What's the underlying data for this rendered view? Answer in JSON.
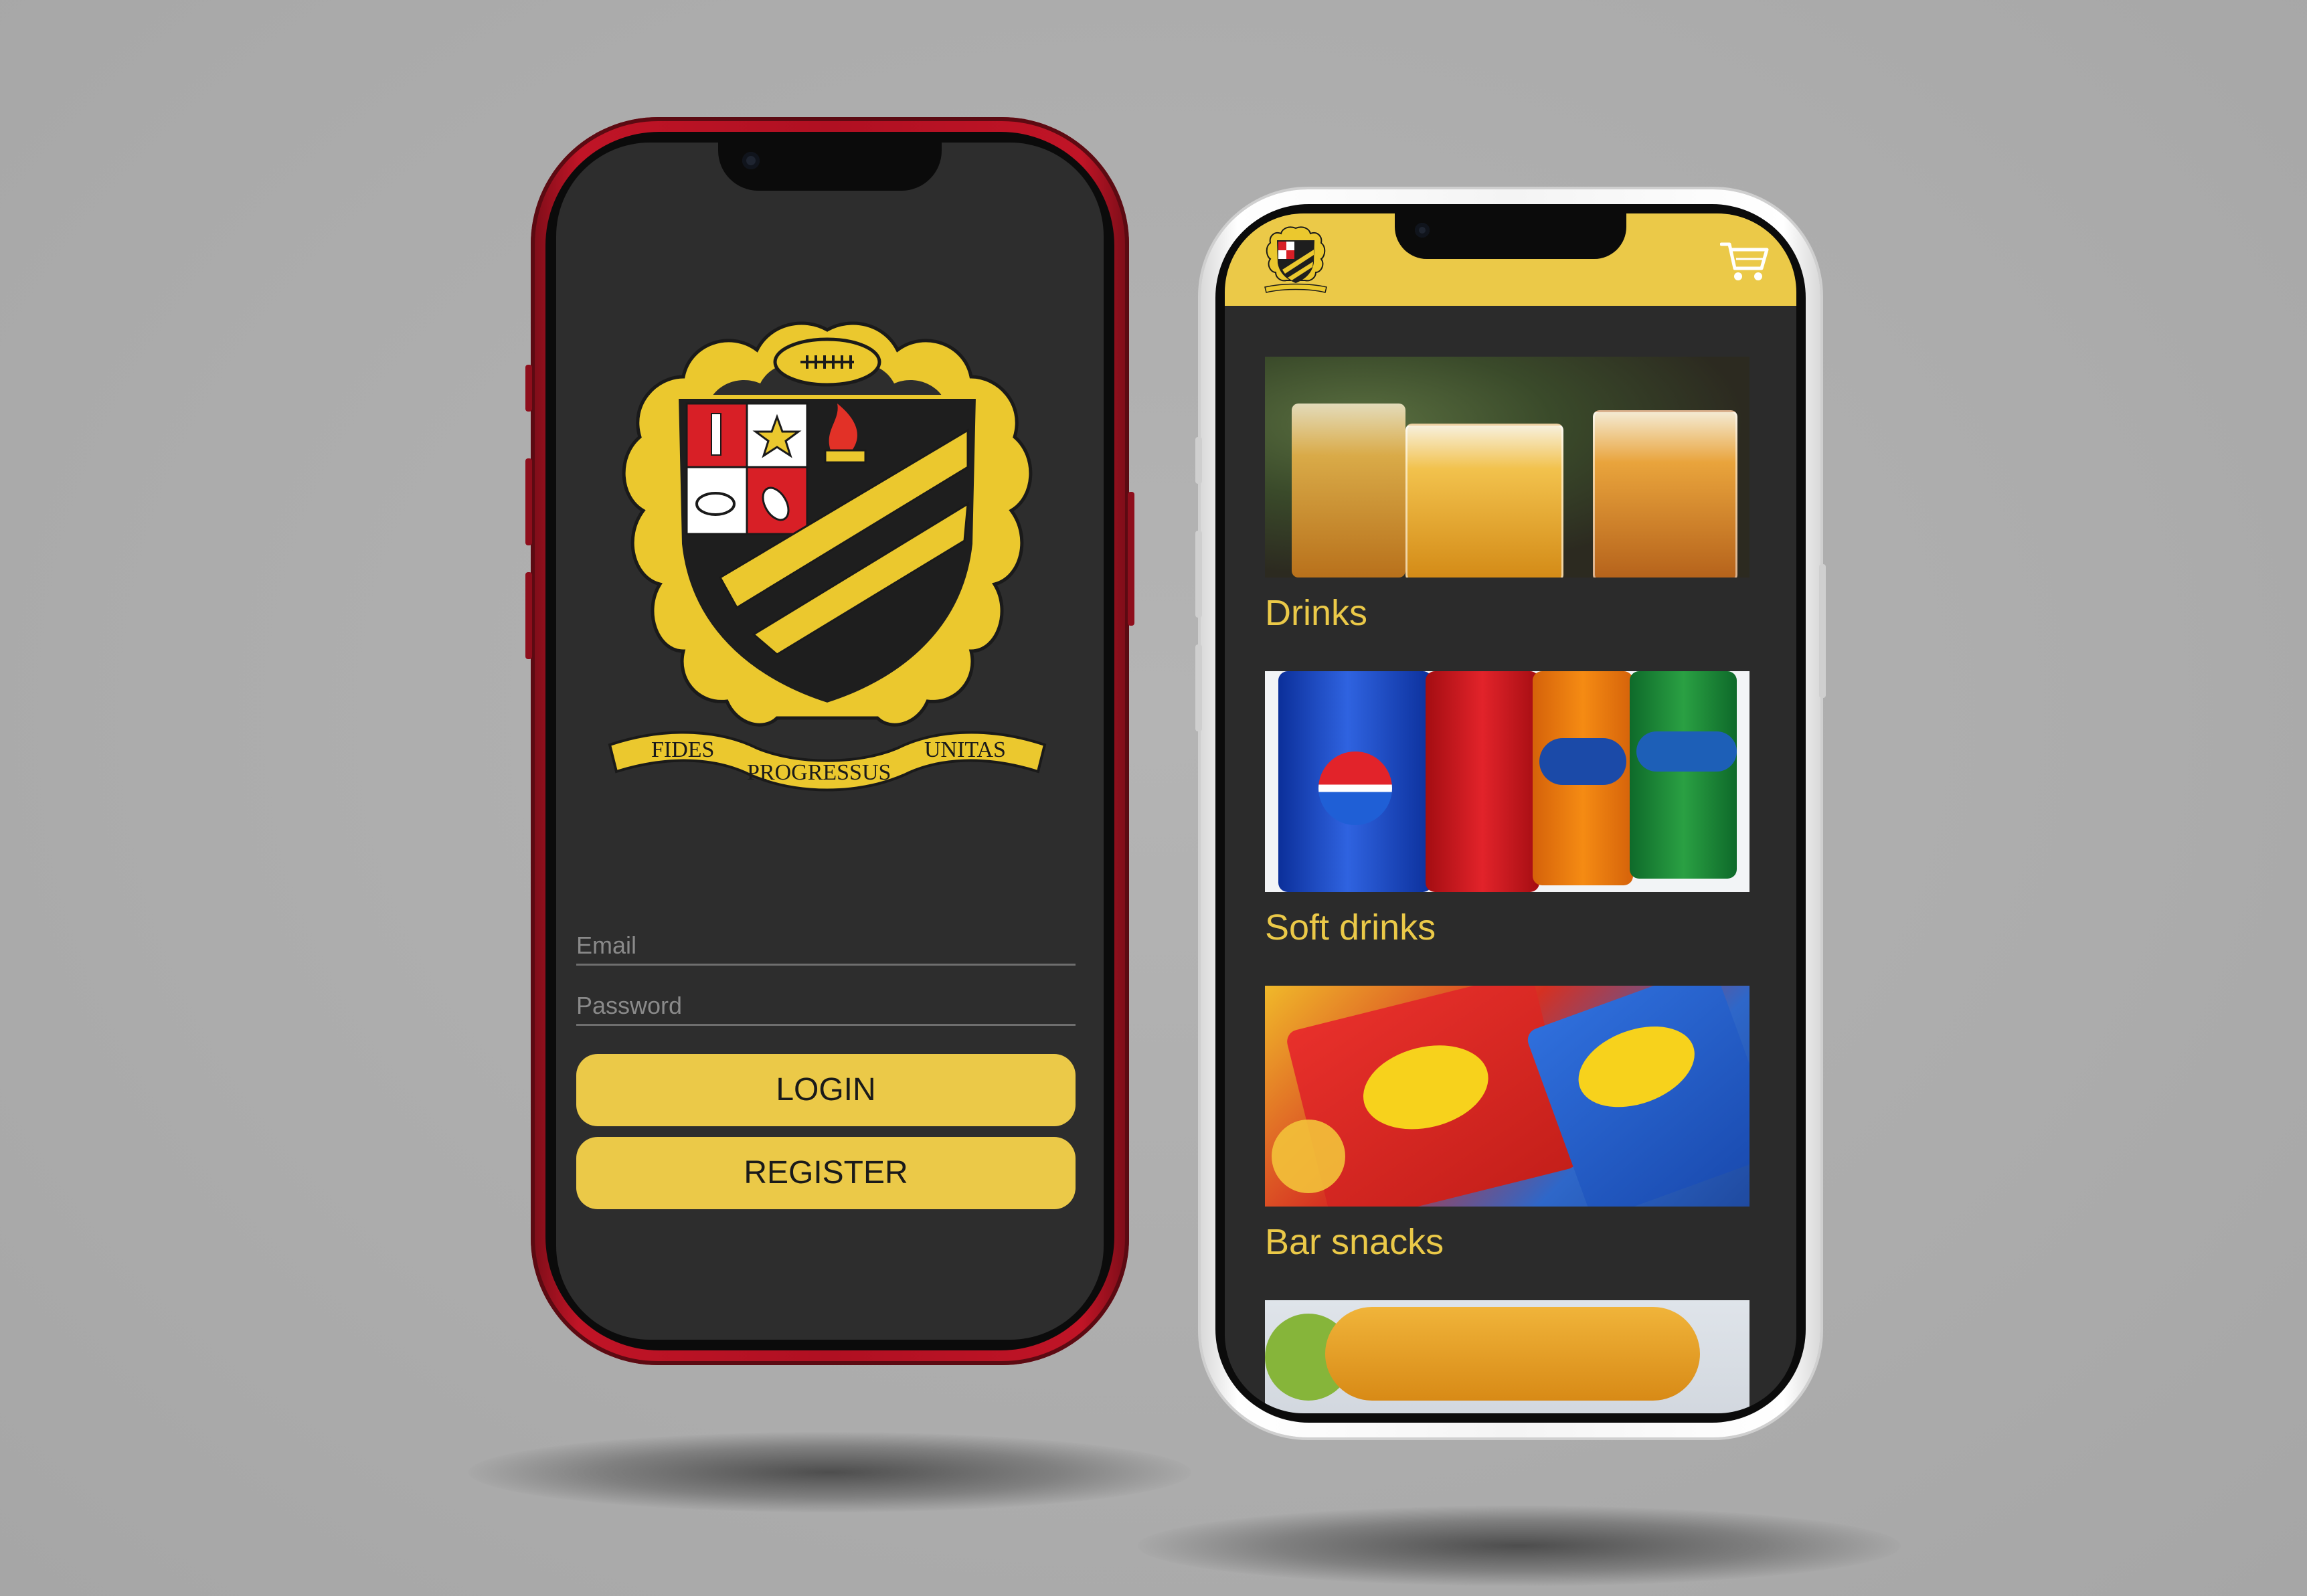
{
  "login_screen": {
    "crest": {
      "motto": [
        "FIDES",
        "PROGRESSUS",
        "UNITAS"
      ]
    },
    "email": {
      "placeholder": "Email"
    },
    "password": {
      "placeholder": "Password"
    },
    "login_label": "LOGIN",
    "register_label": "REGISTER"
  },
  "menu_screen": {
    "header": {
      "logo_icon": "club-crest-icon",
      "cart_icon": "cart-icon"
    },
    "categories": [
      {
        "label": "Drinks",
        "image": "beer-glasses"
      },
      {
        "label": "Soft drinks",
        "image": "soda-cans"
      },
      {
        "label": "Bar snacks",
        "image": "crisp-packets"
      },
      {
        "label": "",
        "image": "fish-and-chips"
      }
    ]
  },
  "colors": {
    "accent": "#ebc948",
    "screen_background": "#2d2d2d",
    "left_phone_frame": "#b01022",
    "right_phone_frame": "#f4f4f4"
  }
}
